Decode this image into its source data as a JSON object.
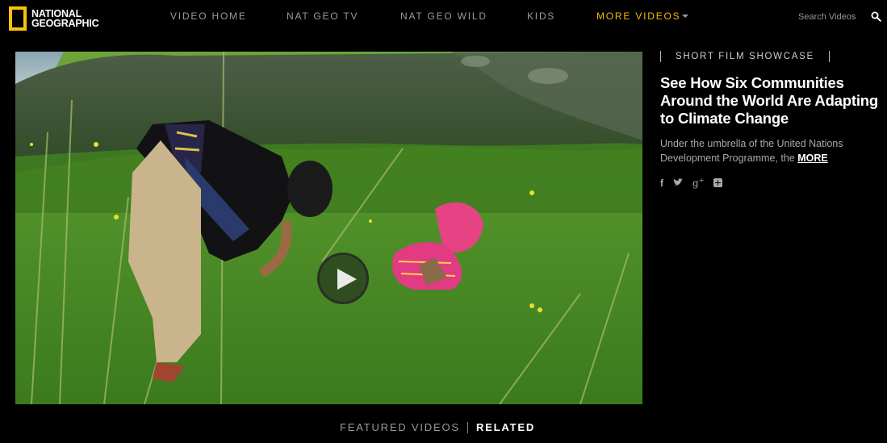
{
  "header": {
    "logo_line1": "NATIONAL",
    "logo_line2": "GEOGRAPHIC",
    "nav": [
      {
        "label": "VIDEO HOME"
      },
      {
        "label": "NAT GEO TV"
      },
      {
        "label": "NAT GEO WILD"
      },
      {
        "label": "KIDS"
      },
      {
        "label": "MORE VIDEOS"
      }
    ],
    "search_placeholder": "Search Videos",
    "accent_color": "#f2b705",
    "logo_color": "#f8c30d"
  },
  "video": {
    "play_icon": "play-icon"
  },
  "sidebar": {
    "category": "SHORT FILM SHOWCASE",
    "title": "See How Six Communities Around the World Are Adapting to Climate Change",
    "description": "Under the umbrella of the United Nations Development Programme, the",
    "more_link": "MORE",
    "social": [
      {
        "icon": "facebook-icon",
        "glyph": "f"
      },
      {
        "icon": "twitter-icon",
        "glyph": "🐦"
      },
      {
        "icon": "google-plus-icon",
        "glyph": "g+"
      },
      {
        "icon": "share-plus-icon",
        "glyph": "+"
      }
    ]
  },
  "tabs": {
    "featured": "FEATURED VIDEOS",
    "related": "RELATED"
  }
}
